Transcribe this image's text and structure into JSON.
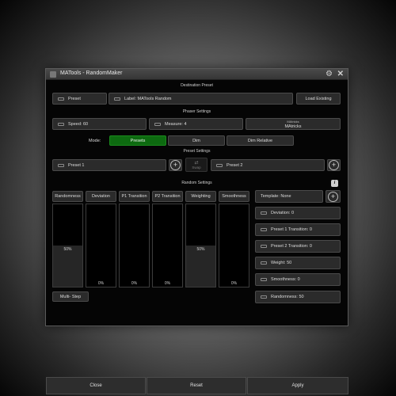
{
  "window": {
    "title": "MATools - RandomMaker"
  },
  "sections": {
    "destination": "Destination Preset",
    "phaser": "Phaser Settings",
    "preset": "Preset Settings",
    "random": "Random Settings"
  },
  "destination": {
    "preset_label": "Preset",
    "label_value": "Label: MATools Random",
    "load_existing": "Load Existing"
  },
  "phaser": {
    "speed": "Speed: 60",
    "measure": "Measure: 4",
    "matricks_top": "MAtricks",
    "matricks_bottom": "MAtricks"
  },
  "mode": {
    "label": "Mode:",
    "options": [
      "Presets",
      "Dim",
      "Dim Relative"
    ],
    "selected": "Presets"
  },
  "preset_settings": {
    "preset1": "Preset 1",
    "swap": "Swap",
    "preset2": "Preset 2"
  },
  "random": {
    "columns": [
      {
        "name": "Randomness",
        "value": "50%"
      },
      {
        "name": "Deviation",
        "value": "0%"
      },
      {
        "name": "P1 Transition",
        "value": "0%"
      },
      {
        "name": "P2 Transition",
        "value": "0%"
      },
      {
        "name": "Weighting",
        "value": "50%"
      },
      {
        "name": "Smoothness",
        "value": "0%"
      }
    ],
    "levels": [
      0.5,
      0,
      0,
      0,
      0.5,
      0
    ],
    "template": "Template: None",
    "settings": [
      "Deviation: 0",
      "Preset 1 Transition: 0",
      "Preset 2 Transition: 0",
      "Weight: 50",
      "Smoothness: 0",
      "Randomness: 50"
    ],
    "multi_step": "Multi- Step"
  },
  "footer": {
    "close": "Close",
    "reset": "Reset",
    "apply": "Apply"
  }
}
